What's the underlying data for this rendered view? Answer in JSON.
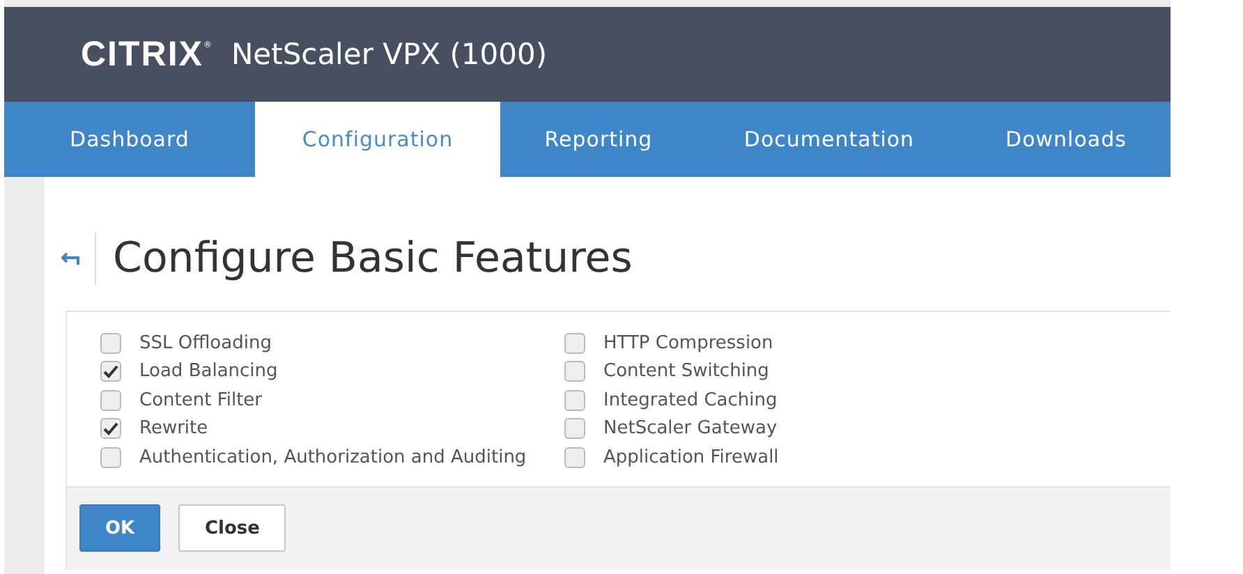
{
  "header": {
    "logo": "CITRIX",
    "trademark": "®",
    "product": "NetScaler VPX (1000)"
  },
  "tabs": [
    {
      "label": "Dashboard",
      "selected": false
    },
    {
      "label": "Configuration",
      "selected": true
    },
    {
      "label": "Reporting",
      "selected": false
    },
    {
      "label": "Documentation",
      "selected": false
    },
    {
      "label": "Downloads",
      "selected": false
    }
  ],
  "page": {
    "title": "Configure Basic Features"
  },
  "features": [
    [
      {
        "label": "SSL Offloading",
        "checked": false
      },
      {
        "label": "Load Balancing",
        "checked": true
      },
      {
        "label": "Content Filter",
        "checked": false
      },
      {
        "label": "Rewrite",
        "checked": true
      },
      {
        "label": "Authentication, Authorization and Auditing",
        "checked": false
      }
    ],
    [
      {
        "label": "HTTP Compression",
        "checked": false
      },
      {
        "label": "Content Switching",
        "checked": false
      },
      {
        "label": "Integrated Caching",
        "checked": false
      },
      {
        "label": "NetScaler Gateway",
        "checked": false
      },
      {
        "label": "Application Firewall",
        "checked": false
      }
    ]
  ],
  "buttons": [
    {
      "label": "OK",
      "kind": "primary"
    },
    {
      "label": "Close",
      "kind": "secondary"
    }
  ]
}
